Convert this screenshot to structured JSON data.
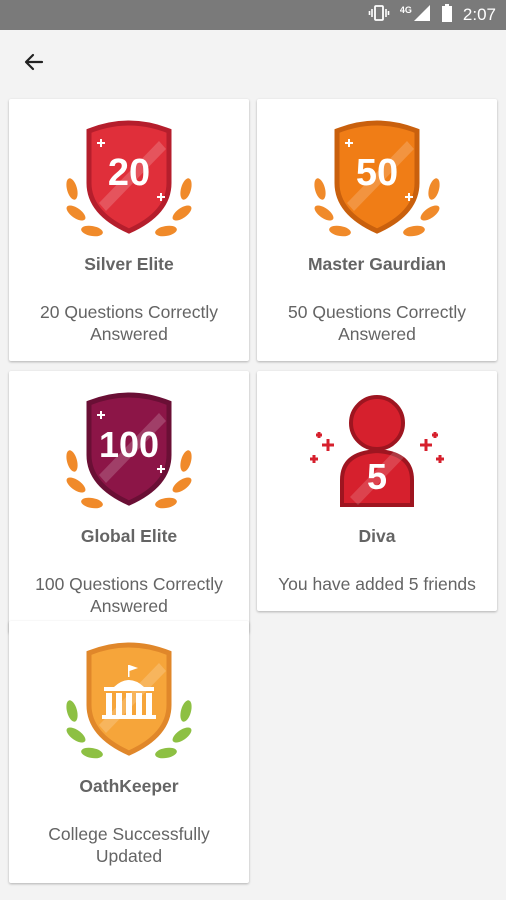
{
  "status_bar": {
    "network": "4G",
    "time": "2:07"
  },
  "badges": [
    {
      "number": "20",
      "title": "Silver Elite",
      "description": "20 Questions Correctly Answered"
    },
    {
      "number": "50",
      "title": "Master Gaurdian",
      "description": "50 Questions Correctly Answered"
    },
    {
      "number": "100",
      "title": "Global Elite",
      "description": "100 Questions Correctly Answered"
    },
    {
      "number": "5",
      "title": "Diva",
      "description": "You have added 5 friends"
    },
    {
      "title": "OathKeeper",
      "description": "College Successfully Updated"
    }
  ],
  "colors": {
    "silver_shield": "#e02f3a",
    "master_shield": "#f07d16",
    "global_shield": "#8c1547",
    "diva_figure": "#d6202d",
    "oath_shield": "#f6a53a",
    "laurel_orange": "#f08a2a",
    "laurel_green": "#8dc043"
  },
  "icons": {
    "back": "arrow-back-icon",
    "vibrate": "vibrate-icon",
    "signal": "signal-icon",
    "battery": "battery-icon"
  }
}
